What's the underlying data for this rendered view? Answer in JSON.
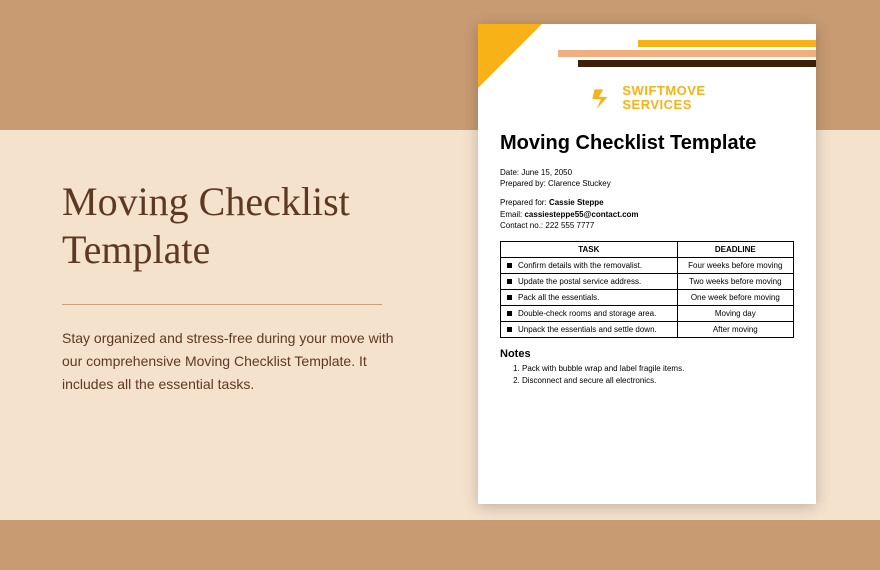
{
  "left": {
    "title": "Moving Checklist Template",
    "description": "Stay organized and stress-free during your move with our comprehensive Moving Checklist Template. It includes all the essential tasks."
  },
  "doc": {
    "brand_line1": "SWIFTMOVE",
    "brand_line2": "SERVICES",
    "title": "Moving Checklist Template",
    "date_label": "Date:",
    "date_value": "June 15, 2050",
    "prepared_by_label": "Prepared by:",
    "prepared_by_value": "Clarence Stuckey",
    "prepared_for_label": "Prepared for:",
    "prepared_for_value": "Cassie Steppe",
    "email_label": "Email:",
    "email_value": "cassiesteppe55@contact.com",
    "contact_label": "Contact no.:",
    "contact_value": "222 555 7777",
    "table": {
      "header_task": "TASK",
      "header_deadline": "DEADLINE",
      "rows": [
        {
          "task": "Confirm details with the removalist.",
          "deadline": "Four weeks before moving"
        },
        {
          "task": "Update the postal service address.",
          "deadline": "Two weeks before moving"
        },
        {
          "task": "Pack all the essentials.",
          "deadline": "One week before moving"
        },
        {
          "task": "Double-check rooms and storage area.",
          "deadline": "Moving day"
        },
        {
          "task": "Unpack the essentials and settle down.",
          "deadline": "After moving"
        }
      ]
    },
    "notes_heading": "Notes",
    "notes": [
      "Pack with bubble wrap and label fragile items.",
      "Disconnect and secure all electronics."
    ]
  }
}
